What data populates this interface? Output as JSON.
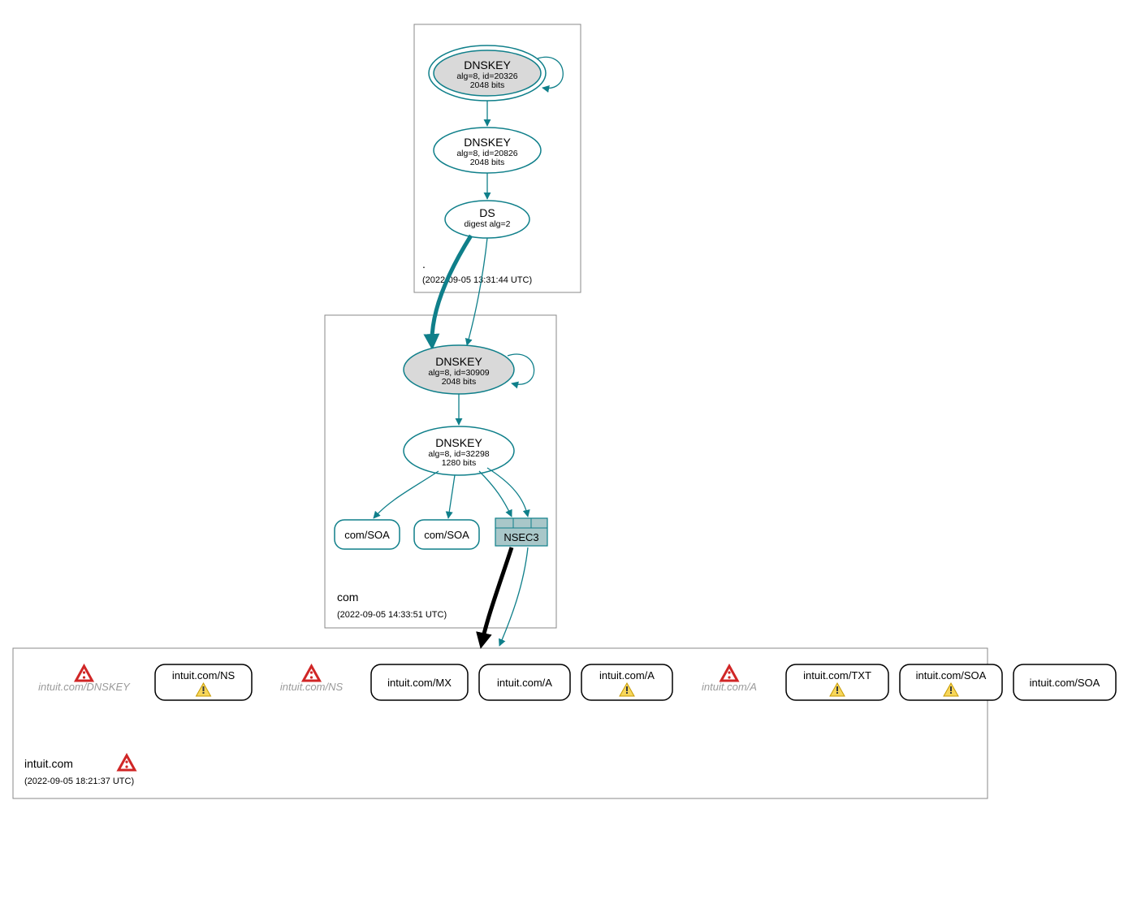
{
  "colors": {
    "teal": "#0f7f8a",
    "grey_fill": "#d9d9d9",
    "box_stroke": "#888888",
    "nsec3_fill": "#a9c7c9",
    "error_red": "#d02626",
    "warn_yellow": "#f3c12e"
  },
  "zones": {
    "root": {
      "label": ".",
      "timestamp": "(2022-09-05 13:31:44 UTC)",
      "nodes": {
        "ksk": {
          "title": "DNSKEY",
          "line1": "alg=8, id=20326",
          "line2": "2048 bits"
        },
        "zsk": {
          "title": "DNSKEY",
          "line1": "alg=8, id=20826",
          "line2": "2048 bits"
        },
        "ds": {
          "title": "DS",
          "line1": "digest alg=2"
        }
      }
    },
    "com": {
      "label": "com",
      "timestamp": "(2022-09-05 14:33:51 UTC)",
      "nodes": {
        "ksk": {
          "title": "DNSKEY",
          "line1": "alg=8, id=30909",
          "line2": "2048 bits"
        },
        "zsk": {
          "title": "DNSKEY",
          "line1": "alg=8, id=32298",
          "line2": "1280 bits"
        }
      },
      "records": {
        "soa1": "com/SOA",
        "soa2": "com/SOA",
        "nsec3": "NSEC3"
      }
    },
    "target": {
      "label": "intuit.com",
      "timestamp": "(2022-09-05 18:21:37 UTC)",
      "records": [
        {
          "label": "intuit.com/DNSKEY",
          "style": "phantom",
          "error": true,
          "warn": false
        },
        {
          "label": "intuit.com/NS",
          "style": "solid",
          "error": false,
          "warn": true
        },
        {
          "label": "intuit.com/NS",
          "style": "phantom",
          "error": true,
          "warn": false
        },
        {
          "label": "intuit.com/MX",
          "style": "solid",
          "error": false,
          "warn": false
        },
        {
          "label": "intuit.com/A",
          "style": "solid",
          "error": false,
          "warn": false
        },
        {
          "label": "intuit.com/A",
          "style": "solid",
          "error": false,
          "warn": true
        },
        {
          "label": "intuit.com/A",
          "style": "phantom",
          "error": true,
          "warn": false
        },
        {
          "label": "intuit.com/TXT",
          "style": "solid",
          "error": false,
          "warn": true
        },
        {
          "label": "intuit.com/SOA",
          "style": "solid",
          "error": false,
          "warn": true
        },
        {
          "label": "intuit.com/SOA",
          "style": "solid",
          "error": false,
          "warn": false
        }
      ]
    }
  }
}
